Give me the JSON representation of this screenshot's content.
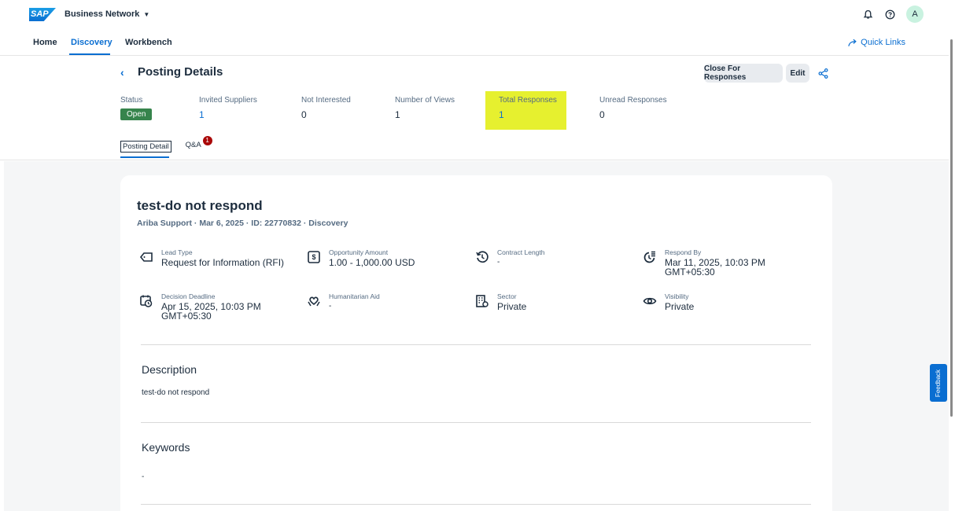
{
  "shell": {
    "logo": "SAP",
    "brand": "Business Network",
    "avatar": "A"
  },
  "nav": {
    "items": [
      "Home",
      "Discovery",
      "Workbench"
    ],
    "quick_links": "Quick Links"
  },
  "header": {
    "title": "Posting Details",
    "close_button": "Close For Responses",
    "edit_button": "Edit",
    "kpis": {
      "status": {
        "label": "Status",
        "value": "Open"
      },
      "invited": {
        "label": "Invited Suppliers",
        "value": "1"
      },
      "not_interested": {
        "label": "Not Interested",
        "value": "0"
      },
      "views": {
        "label": "Number of Views",
        "value": "1"
      },
      "total_responses": {
        "label": "Total Responses",
        "value": "1"
      },
      "unread": {
        "label": "Unread Responses",
        "value": "0"
      }
    },
    "tabs": [
      {
        "label": "Posting Detail"
      },
      {
        "label": "Q&A",
        "badge": "1"
      }
    ]
  },
  "posting": {
    "title": "test-do not respond",
    "subtitle": "Ariba Support · Mar 6, 2025 · ID: 22770832 · Discovery",
    "fields": {
      "lead_type": {
        "label": "Lead Type",
        "value": "Request for Information (RFI)"
      },
      "opportunity_amount": {
        "label": "Opportunity Amount",
        "value": "1.00 - 1,000.00 USD"
      },
      "contract_length": {
        "label": "Contract Length",
        "value": "-"
      },
      "respond_by": {
        "label": "Respond By",
        "value": "Mar 11, 2025, 10:03 PM GMT+05:30"
      },
      "decision_deadline": {
        "label": "Decision Deadline",
        "value": "Apr 15, 2025, 10:03 PM GMT+05:30"
      },
      "humanitarian_aid": {
        "label": "Humanitarian Aid",
        "value": "-"
      },
      "sector": {
        "label": "Sector",
        "value": "Private"
      },
      "visibility": {
        "label": "Visibility",
        "value": "Private"
      }
    },
    "description": {
      "title": "Description",
      "text": "test-do not respond"
    },
    "keywords": {
      "title": "Keywords",
      "text": "-"
    }
  },
  "feedback": "Feedback",
  "colors": {
    "accent": "#0a6ed1",
    "status_green": "#36844c",
    "highlight": "#e6f02f",
    "badge_red": "#aa0808"
  }
}
